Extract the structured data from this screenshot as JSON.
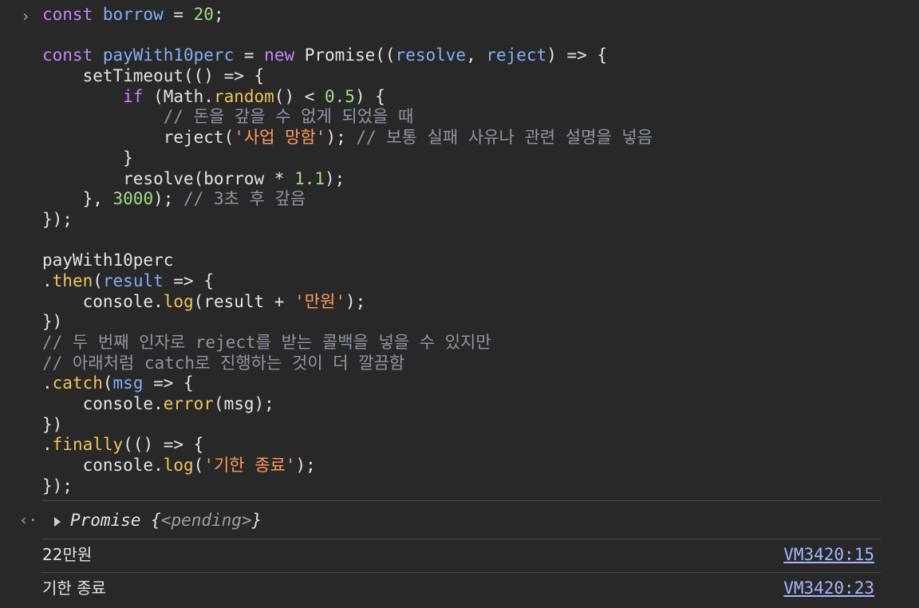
{
  "input": {
    "prompt_icon": "chevron-right-icon",
    "code_lines": [
      [
        [
          "k",
          "const "
        ],
        [
          "v",
          "borrow"
        ],
        [
          "p",
          " = "
        ],
        [
          "n",
          "20"
        ],
        [
          "p",
          ";"
        ]
      ],
      [],
      [
        [
          "k",
          "const "
        ],
        [
          "v",
          "payWith10perc"
        ],
        [
          "p",
          " = "
        ],
        [
          "k",
          "new "
        ],
        [
          "p",
          "Promise(("
        ],
        [
          "v",
          "resolve"
        ],
        [
          "p",
          ", "
        ],
        [
          "v",
          "reject"
        ],
        [
          "p",
          ") => {"
        ]
      ],
      [
        [
          "p",
          "    setTimeout(() => {"
        ]
      ],
      [
        [
          "k",
          "        if "
        ],
        [
          "p",
          "(Math."
        ],
        [
          "m",
          "random"
        ],
        [
          "p",
          "() < "
        ],
        [
          "n",
          "0.5"
        ],
        [
          "p",
          ") {"
        ]
      ],
      [
        [
          "c",
          "            // 돈을 갚을 수 없게 되었을 때"
        ]
      ],
      [
        [
          "p",
          "            reject("
        ],
        [
          "s",
          "'사업 망함'"
        ],
        [
          "p",
          "); "
        ],
        [
          "c",
          "// 보통 실패 사유나 관련 설명을 넣음"
        ]
      ],
      [
        [
          "p",
          "        }"
        ]
      ],
      [
        [
          "p",
          "        resolve(borrow * "
        ],
        [
          "n",
          "1.1"
        ],
        [
          "p",
          ");"
        ]
      ],
      [
        [
          "p",
          "    }, "
        ],
        [
          "n",
          "3000"
        ],
        [
          "p",
          "); "
        ],
        [
          "c",
          "// 3초 후 갚음"
        ]
      ],
      [
        [
          "p",
          "});"
        ]
      ],
      [],
      [
        [
          "p",
          "payWith10perc"
        ]
      ],
      [
        [
          "p",
          "."
        ],
        [
          "m",
          "then"
        ],
        [
          "p",
          "("
        ],
        [
          "v",
          "result"
        ],
        [
          "p",
          " => {"
        ]
      ],
      [
        [
          "p",
          "    console."
        ],
        [
          "m",
          "log"
        ],
        [
          "p",
          "(result + "
        ],
        [
          "s",
          "'만원'"
        ],
        [
          "p",
          ");"
        ]
      ],
      [
        [
          "p",
          "})"
        ]
      ],
      [
        [
          "c",
          "// 두 번째 인자로 reject를 받는 콜백을 넣을 수 있지만"
        ]
      ],
      [
        [
          "c",
          "// 아래처럼 catch로 진행하는 것이 더 깔끔함"
        ]
      ],
      [
        [
          "p",
          "."
        ],
        [
          "m",
          "catch"
        ],
        [
          "p",
          "("
        ],
        [
          "v",
          "msg"
        ],
        [
          "p",
          " => {"
        ]
      ],
      [
        [
          "p",
          "    console."
        ],
        [
          "m",
          "error"
        ],
        [
          "p",
          "(msg);"
        ]
      ],
      [
        [
          "p",
          "})"
        ]
      ],
      [
        [
          "p",
          "."
        ],
        [
          "m",
          "finally"
        ],
        [
          "p",
          "(() => {"
        ]
      ],
      [
        [
          "p",
          "    console."
        ],
        [
          "m",
          "log"
        ],
        [
          "p",
          "("
        ],
        [
          "s",
          "'기한 종료'"
        ],
        [
          "p",
          ");"
        ]
      ],
      [
        [
          "p",
          "});"
        ]
      ]
    ]
  },
  "result": {
    "return_icon": "chevron-left-icon",
    "expand_icon": "triangle-right-icon",
    "label": "Promise {",
    "pending": "<pending>",
    "close": "}"
  },
  "logs": [
    {
      "text": "22만원",
      "source": "VM3420:15"
    },
    {
      "text": "기한 종료",
      "source": "VM3420:23"
    }
  ],
  "colors": {
    "background": "#282828",
    "keyword": "#c586f6",
    "variable": "#84aef7",
    "method": "#f0c35d",
    "number": "#a5dd86",
    "string": "#ff9a60",
    "comment": "#8f95a3",
    "link": "#a7b4ff"
  }
}
